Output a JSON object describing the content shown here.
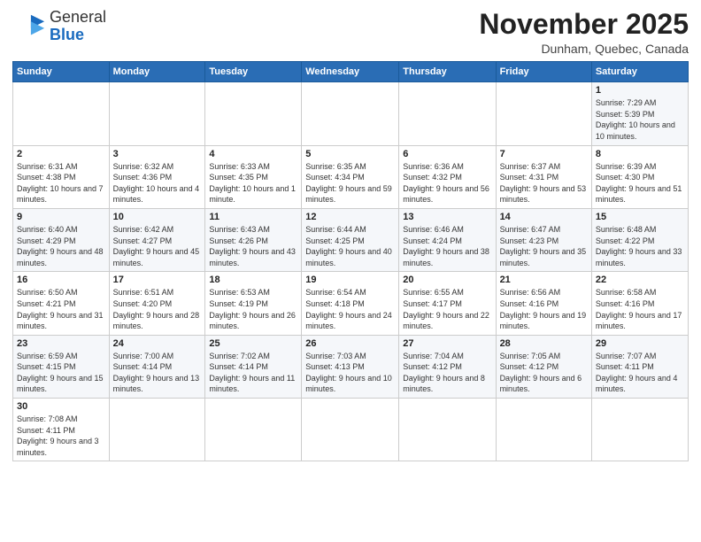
{
  "logo": {
    "general": "General",
    "blue": "Blue"
  },
  "title": "November 2025",
  "location": "Dunham, Quebec, Canada",
  "days_of_week": [
    "Sunday",
    "Monday",
    "Tuesday",
    "Wednesday",
    "Thursday",
    "Friday",
    "Saturday"
  ],
  "weeks": [
    [
      null,
      null,
      null,
      null,
      null,
      null,
      {
        "day": "1",
        "info": "Sunrise: 7:29 AM\nSunset: 5:39 PM\nDaylight: 10 hours and 10 minutes."
      }
    ],
    [
      {
        "day": "2",
        "info": "Sunrise: 6:31 AM\nSunset: 4:38 PM\nDaylight: 10 hours and 7 minutes."
      },
      {
        "day": "3",
        "info": "Sunrise: 6:32 AM\nSunset: 4:36 PM\nDaylight: 10 hours and 4 minutes."
      },
      {
        "day": "4",
        "info": "Sunrise: 6:33 AM\nSunset: 4:35 PM\nDaylight: 10 hours and 1 minute."
      },
      {
        "day": "5",
        "info": "Sunrise: 6:35 AM\nSunset: 4:34 PM\nDaylight: 9 hours and 59 minutes."
      },
      {
        "day": "6",
        "info": "Sunrise: 6:36 AM\nSunset: 4:32 PM\nDaylight: 9 hours and 56 minutes."
      },
      {
        "day": "7",
        "info": "Sunrise: 6:37 AM\nSunset: 4:31 PM\nDaylight: 9 hours and 53 minutes."
      },
      {
        "day": "8",
        "info": "Sunrise: 6:39 AM\nSunset: 4:30 PM\nDaylight: 9 hours and 51 minutes."
      }
    ],
    [
      {
        "day": "9",
        "info": "Sunrise: 6:40 AM\nSunset: 4:29 PM\nDaylight: 9 hours and 48 minutes."
      },
      {
        "day": "10",
        "info": "Sunrise: 6:42 AM\nSunset: 4:27 PM\nDaylight: 9 hours and 45 minutes."
      },
      {
        "day": "11",
        "info": "Sunrise: 6:43 AM\nSunset: 4:26 PM\nDaylight: 9 hours and 43 minutes."
      },
      {
        "day": "12",
        "info": "Sunrise: 6:44 AM\nSunset: 4:25 PM\nDaylight: 9 hours and 40 minutes."
      },
      {
        "day": "13",
        "info": "Sunrise: 6:46 AM\nSunset: 4:24 PM\nDaylight: 9 hours and 38 minutes."
      },
      {
        "day": "14",
        "info": "Sunrise: 6:47 AM\nSunset: 4:23 PM\nDaylight: 9 hours and 35 minutes."
      },
      {
        "day": "15",
        "info": "Sunrise: 6:48 AM\nSunset: 4:22 PM\nDaylight: 9 hours and 33 minutes."
      }
    ],
    [
      {
        "day": "16",
        "info": "Sunrise: 6:50 AM\nSunset: 4:21 PM\nDaylight: 9 hours and 31 minutes."
      },
      {
        "day": "17",
        "info": "Sunrise: 6:51 AM\nSunset: 4:20 PM\nDaylight: 9 hours and 28 minutes."
      },
      {
        "day": "18",
        "info": "Sunrise: 6:53 AM\nSunset: 4:19 PM\nDaylight: 9 hours and 26 minutes."
      },
      {
        "day": "19",
        "info": "Sunrise: 6:54 AM\nSunset: 4:18 PM\nDaylight: 9 hours and 24 minutes."
      },
      {
        "day": "20",
        "info": "Sunrise: 6:55 AM\nSunset: 4:17 PM\nDaylight: 9 hours and 22 minutes."
      },
      {
        "day": "21",
        "info": "Sunrise: 6:56 AM\nSunset: 4:16 PM\nDaylight: 9 hours and 19 minutes."
      },
      {
        "day": "22",
        "info": "Sunrise: 6:58 AM\nSunset: 4:16 PM\nDaylight: 9 hours and 17 minutes."
      }
    ],
    [
      {
        "day": "23",
        "info": "Sunrise: 6:59 AM\nSunset: 4:15 PM\nDaylight: 9 hours and 15 minutes."
      },
      {
        "day": "24",
        "info": "Sunrise: 7:00 AM\nSunset: 4:14 PM\nDaylight: 9 hours and 13 minutes."
      },
      {
        "day": "25",
        "info": "Sunrise: 7:02 AM\nSunset: 4:14 PM\nDaylight: 9 hours and 11 minutes."
      },
      {
        "day": "26",
        "info": "Sunrise: 7:03 AM\nSunset: 4:13 PM\nDaylight: 9 hours and 10 minutes."
      },
      {
        "day": "27",
        "info": "Sunrise: 7:04 AM\nSunset: 4:12 PM\nDaylight: 9 hours and 8 minutes."
      },
      {
        "day": "28",
        "info": "Sunrise: 7:05 AM\nSunset: 4:12 PM\nDaylight: 9 hours and 6 minutes."
      },
      {
        "day": "29",
        "info": "Sunrise: 7:07 AM\nSunset: 4:11 PM\nDaylight: 9 hours and 4 minutes."
      }
    ],
    [
      {
        "day": "30",
        "info": "Sunrise: 7:08 AM\nSunset: 4:11 PM\nDaylight: 9 hours and 3 minutes."
      },
      null,
      null,
      null,
      null,
      null,
      null
    ]
  ]
}
